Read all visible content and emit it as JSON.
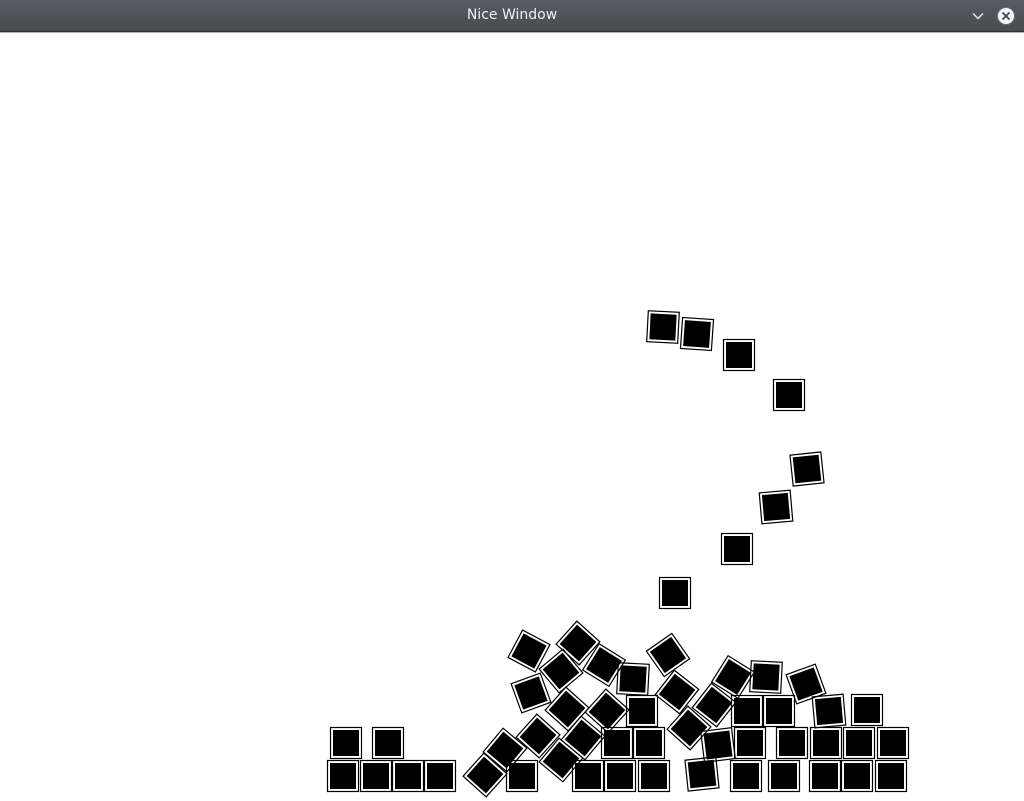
{
  "window": {
    "title": "Nice Window"
  },
  "icons": {
    "minimize": "chevron-down-icon",
    "close": "close-icon"
  },
  "colors": {
    "titlebar": "#4b5157",
    "title_text": "#eef0f2",
    "canvas_background": "#ffffff",
    "box_fill": "#000000",
    "box_outline": "#000000"
  }
}
